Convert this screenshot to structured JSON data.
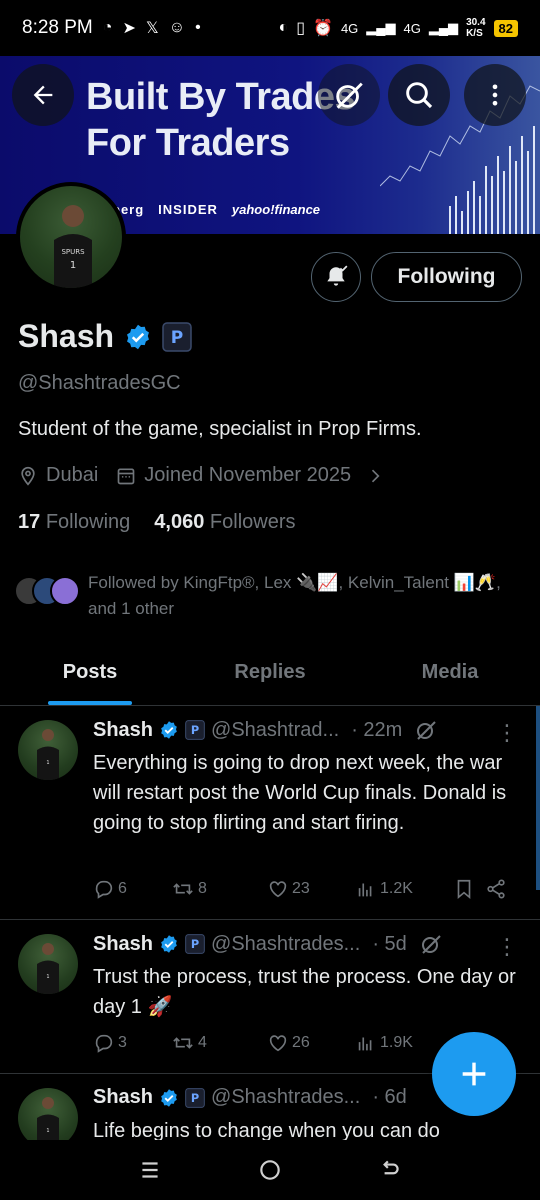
{
  "status": {
    "time": "8:28 PM",
    "network_speed": "30.4",
    "speed_unit": "K/S",
    "net1": "4G",
    "net2": "4G",
    "battery": "82"
  },
  "banner": {
    "title_line1": "Built By Trades",
    "title_line2": "For Traders",
    "logos": [
      "berg",
      "INSIDER",
      "yahoo!finance"
    ]
  },
  "profile": {
    "name": "Shash",
    "handle": "@ShashtradesGC",
    "bio": "Student of the game, specialist in Prop Firms.",
    "location": "Dubai",
    "joined": "Joined November 2025",
    "following_count": "17",
    "following_label": "Following",
    "followers_count": "4,060",
    "followers_label": "Followers",
    "follow_button": "Following",
    "followed_by": "Followed by KingFtp®, Lex 🔌📈, Kelvin_Talent 📊🥂, and 1 other"
  },
  "tabs": [
    {
      "label": "Posts",
      "active": true
    },
    {
      "label": "Replies",
      "active": false
    },
    {
      "label": "Media",
      "active": false
    }
  ],
  "tweets": [
    {
      "name": "Shash",
      "handle": "@Shashtrad...",
      "time": "· 22m",
      "text": "Everything is going to drop next week, the war will restart post the World Cup finals. Donald is going to stop flirting and start firing.",
      "replies": "6",
      "retweets": "8",
      "likes": "23",
      "views": "1.2K"
    },
    {
      "name": "Shash",
      "handle": "@Shashtrades...",
      "time": "· 5d",
      "text": "Trust the process, trust the process. One day or day 1 🚀",
      "replies": "3",
      "retweets": "4",
      "likes": "26",
      "views": "1.9K"
    },
    {
      "name": "Shash",
      "handle": "@Shashtrades...",
      "time": "· 6d",
      "text": "Life begins to change when you can do"
    }
  ],
  "colors": {
    "accent": "#1d9bf0",
    "verified": "#1d9bf0",
    "muted": "#71767b",
    "battery": "#f5c400"
  }
}
